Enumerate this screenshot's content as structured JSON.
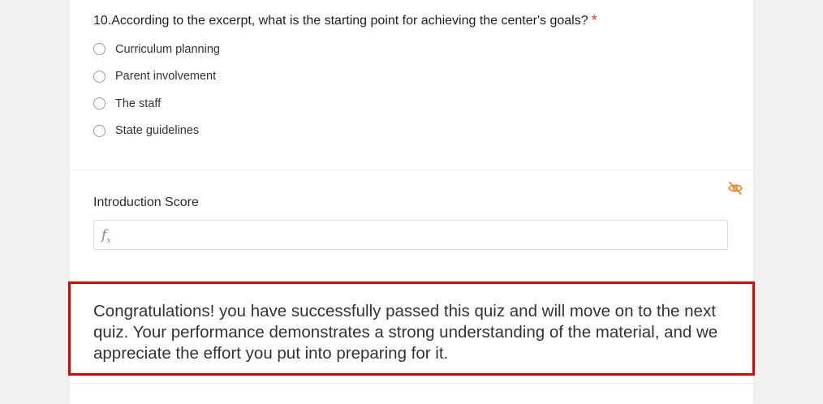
{
  "question": {
    "title": "10.According to the excerpt, what is the starting point for achieving the center's goals?",
    "required_marker": "*",
    "options": [
      "Curriculum planning",
      "Parent involvement",
      "The staff",
      "State guidelines"
    ]
  },
  "score_field": {
    "label": "Introduction Score",
    "visibility_icon": "eye-off-icon",
    "input_icon": "fx-icon"
  },
  "message": {
    "text": "Congratulations! you have successfully passed this quiz and will move on to the next quiz. Your performance demonstrates a strong understanding of the material, and we appreciate the effort you put into preparing for it."
  },
  "colors": {
    "required": "#e53935",
    "hidden_icon": "#e0913a",
    "highlight_border": "#e60000",
    "page_background": "#f1f1f1"
  }
}
